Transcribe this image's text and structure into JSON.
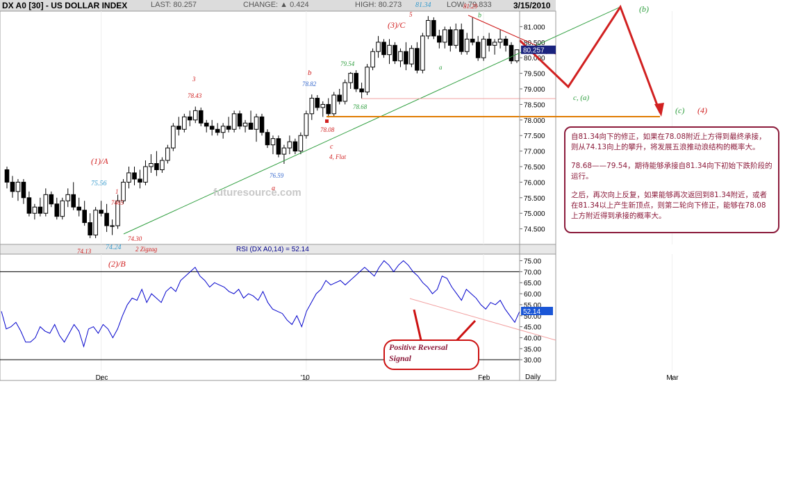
{
  "header": {
    "symbol": "DX A0 [30] - US DOLLAR INDEX",
    "last": "LAST: 80.257",
    "change": "CHANGE: ▲ 0.424",
    "high": "HIGH: 80.273",
    "low": "LOW: 79.833",
    "date": "3/15/2010"
  },
  "chart_data": [
    {
      "type": "candlestick",
      "title": "DX A0 [30] - US DOLLAR INDEX",
      "ylim": [
        74.0,
        81.5
      ],
      "yticks": [
        "81.000",
        "80.500",
        "80.000",
        "79.500",
        "79.000",
        "78.500",
        "78.000",
        "77.500",
        "77.000",
        "76.500",
        "76.000",
        "75.500",
        "75.000",
        "74.500"
      ],
      "last_price_label": "80.257",
      "watermark": "futuresource.com",
      "x_tick_labels": [
        "Dec",
        "'10",
        "Feb",
        "Mar"
      ],
      "x_tick_positions": [
        17,
        54,
        86,
        120
      ],
      "candles": [
        [
          76.4,
          76.5,
          75.8,
          76.0
        ],
        [
          76.0,
          76.2,
          75.5,
          75.7
        ],
        [
          75.7,
          76.1,
          75.4,
          76.0
        ],
        [
          76.0,
          76.1,
          75.3,
          75.5
        ],
        [
          75.5,
          75.7,
          74.9,
          75.0
        ],
        [
          75.0,
          75.3,
          74.8,
          75.2
        ],
        [
          75.2,
          75.5,
          74.9,
          75.0
        ],
        [
          75.0,
          75.8,
          74.9,
          75.6
        ],
        [
          75.6,
          75.7,
          75.2,
          75.3
        ],
        [
          75.3,
          75.5,
          74.8,
          74.9
        ],
        [
          74.9,
          75.5,
          74.8,
          75.4
        ],
        [
          75.4,
          75.8,
          75.2,
          75.6
        ],
        [
          75.6,
          76.0,
          75.1,
          75.2
        ],
        [
          75.2,
          75.5,
          74.9,
          75.1
        ],
        [
          75.1,
          75.4,
          74.6,
          74.7
        ],
        [
          74.7,
          75.0,
          74.2,
          74.3
        ],
        [
          74.3,
          75.2,
          74.2,
          75.1
        ],
        [
          75.1,
          75.4,
          74.9,
          75.0
        ],
        [
          75.0,
          75.3,
          74.4,
          74.6
        ],
        [
          74.6,
          74.8,
          74.3,
          74.6
        ],
        [
          74.6,
          75.6,
          74.5,
          75.4
        ],
        [
          75.4,
          76.1,
          75.3,
          76.0
        ],
        [
          76.0,
          76.5,
          75.8,
          76.3
        ],
        [
          76.3,
          76.5,
          75.9,
          76.1
        ],
        [
          76.1,
          76.4,
          75.8,
          76.0
        ],
        [
          76.0,
          76.7,
          75.9,
          76.5
        ],
        [
          76.5,
          76.9,
          76.3,
          76.6
        ],
        [
          76.6,
          77.0,
          76.2,
          76.4
        ],
        [
          76.4,
          76.8,
          76.3,
          76.7
        ],
        [
          76.7,
          77.2,
          76.6,
          77.1
        ],
        [
          77.1,
          77.9,
          77.0,
          77.8
        ],
        [
          77.8,
          78.1,
          77.5,
          77.7
        ],
        [
          77.7,
          78.2,
          77.6,
          78.1
        ],
        [
          78.1,
          78.3,
          77.8,
          78.0
        ],
        [
          78.0,
          78.43,
          77.9,
          78.3
        ],
        [
          78.3,
          78.4,
          77.8,
          77.9
        ],
        [
          77.9,
          78.0,
          77.6,
          77.8
        ],
        [
          77.8,
          78.0,
          77.5,
          77.7
        ],
        [
          77.7,
          77.9,
          77.5,
          77.6
        ],
        [
          77.6,
          77.9,
          77.4,
          77.8
        ],
        [
          77.8,
          78.1,
          77.6,
          77.7
        ],
        [
          77.7,
          78.3,
          77.6,
          78.2
        ],
        [
          78.2,
          78.3,
          77.7,
          77.8
        ],
        [
          77.8,
          78.0,
          77.6,
          77.9
        ],
        [
          77.9,
          78.3,
          77.7,
          77.7
        ],
        [
          77.7,
          78.2,
          77.3,
          78.1
        ],
        [
          78.1,
          78.2,
          77.5,
          77.6
        ],
        [
          77.6,
          77.7,
          77.1,
          77.2
        ],
        [
          77.2,
          77.5,
          76.9,
          77.4
        ],
        [
          77.4,
          77.5,
          76.8,
          76.9
        ],
        [
          76.9,
          77.2,
          76.59,
          77.1
        ],
        [
          77.1,
          77.5,
          76.9,
          77.3
        ],
        [
          77.3,
          77.4,
          76.9,
          77.0
        ],
        [
          77.0,
          77.6,
          76.9,
          77.5
        ],
        [
          77.5,
          78.3,
          77.4,
          78.2
        ],
        [
          78.2,
          78.82,
          78.0,
          78.7
        ],
        [
          78.7,
          78.8,
          78.3,
          78.4
        ],
        [
          78.4,
          78.6,
          78.1,
          78.5
        ],
        [
          78.5,
          78.7,
          78.08,
          78.2
        ],
        [
          78.2,
          78.9,
          78.1,
          78.8
        ],
        [
          78.8,
          79.0,
          78.5,
          78.6
        ],
        [
          78.6,
          79.3,
          78.5,
          79.2
        ],
        [
          79.2,
          79.54,
          79.0,
          79.5
        ],
        [
          79.5,
          79.6,
          78.9,
          79.0
        ],
        [
          79.0,
          79.2,
          78.68,
          78.9
        ],
        [
          78.9,
          79.8,
          78.8,
          79.7
        ],
        [
          79.7,
          80.3,
          79.6,
          80.2
        ],
        [
          80.2,
          80.7,
          80.0,
          80.5
        ],
        [
          80.5,
          80.6,
          80.0,
          80.1
        ],
        [
          80.1,
          80.6,
          79.8,
          80.4
        ],
        [
          80.4,
          80.5,
          79.8,
          79.9
        ],
        [
          79.9,
          80.3,
          79.7,
          80.2
        ],
        [
          80.2,
          80.5,
          79.6,
          79.8
        ],
        [
          79.8,
          80.4,
          79.7,
          80.3
        ],
        [
          80.3,
          80.5,
          79.5,
          79.6
        ],
        [
          79.6,
          80.8,
          79.5,
          80.7
        ],
        [
          80.7,
          81.34,
          80.6,
          81.2
        ],
        [
          81.2,
          81.3,
          80.6,
          80.7
        ],
        [
          80.7,
          80.9,
          80.3,
          80.5
        ],
        [
          80.5,
          81.0,
          80.3,
          80.9
        ],
        [
          80.9,
          81.0,
          80.2,
          80.4
        ],
        [
          80.4,
          81.1,
          80.3,
          80.9
        ],
        [
          80.9,
          81.1,
          80.1,
          80.2
        ],
        [
          80.2,
          80.8,
          80.1,
          80.6
        ],
        [
          80.6,
          81.29,
          80.4,
          80.5
        ],
        [
          80.5,
          80.7,
          79.9,
          80.0
        ],
        [
          80.0,
          80.7,
          79.9,
          80.6
        ],
        [
          80.6,
          80.8,
          80.2,
          80.4
        ],
        [
          80.4,
          80.6,
          80.1,
          80.5
        ],
        [
          80.5,
          80.9,
          80.3,
          80.6
        ],
        [
          80.6,
          80.7,
          80.2,
          80.4
        ],
        [
          80.4,
          80.5,
          79.8,
          79.9
        ],
        [
          79.9,
          80.273,
          79.833,
          80.257
        ]
      ]
    },
    {
      "type": "line",
      "title": "RSI (DX A0,14) = 52.14",
      "ylim": [
        25,
        78
      ],
      "yticks": [
        "75.00",
        "70.00",
        "65.00",
        "60.00",
        "55.00",
        "50.00",
        "45.00",
        "40.00",
        "35.00",
        "30.00"
      ],
      "last_value_label": "52.14",
      "x_tick_labels": [
        "Dec",
        "'10",
        "Feb",
        "Mar"
      ],
      "axis_name": "Daily",
      "values": [
        52,
        44,
        45,
        47,
        43,
        38,
        38,
        40,
        45,
        43,
        42,
        46,
        41,
        38,
        42,
        46,
        43,
        36,
        44,
        45,
        42,
        46,
        44,
        40,
        44,
        50,
        55,
        58,
        57,
        62,
        56,
        60,
        58,
        56,
        61,
        63,
        61,
        66,
        68,
        70,
        72,
        68,
        66,
        63,
        65,
        64,
        63,
        61,
        60,
        62,
        58,
        60,
        59,
        57,
        61,
        56,
        53,
        52,
        51,
        48,
        46,
        50,
        45,
        52,
        56,
        60,
        62,
        66,
        64,
        65,
        66,
        64,
        66,
        68,
        70,
        72,
        70,
        68,
        72,
        75,
        73,
        70,
        73,
        75,
        73,
        70,
        68,
        65,
        63,
        60,
        62,
        68,
        67,
        63,
        60,
        57,
        62,
        60,
        58,
        55,
        53,
        56,
        55,
        57,
        53,
        50,
        47,
        52
      ],
      "reference_lines": [
        70,
        30
      ]
    }
  ],
  "annotations": {
    "wave_labels": {
      "w1A": "(1)/A",
      "w2B": "(2)/B",
      "w3C": "(3)/C",
      "w4": "(4)",
      "wc": "(c)",
      "wb": "(b)",
      "wca": "c, (a)",
      "sub5": "5",
      "sub3": "3",
      "sub1": "1",
      "sub2zig": "2 Zigzag",
      "subb1": "b",
      "subb2": "b",
      "suba1": "a",
      "suba2": "a",
      "subc": "c",
      "flat": "4, Flat"
    },
    "prices": {
      "p7556": "75.56",
      "p7465": "7465",
      "p7430": "74.30",
      "p7424": "74.24",
      "p7413": "74.13",
      "p7843": "78.43",
      "p7882": "78.82",
      "p7954": "79.54",
      "p7868": "78.68",
      "p7808": "78.08",
      "p7659": "76.59",
      "p8134": "81.34",
      "p8129": "81.29"
    },
    "signal_label": "Positive Reversal Signal",
    "notes": [
      "自81.34向下的修正，如果在78.08附近上方得到最终承接，则从74.13向上的攀升，将发展五浪推动浪结构的概率大。",
      "78.68——79.54，期待能够承接自81.34向下初始下跌阶段的运行。",
      "之后，再次向上反复，如果能够再次返回到81.34附近，或者在81.34以上产生新顶点，则第二轮向下修正，能够在78.08上方附近得到承接的概率大。"
    ]
  }
}
